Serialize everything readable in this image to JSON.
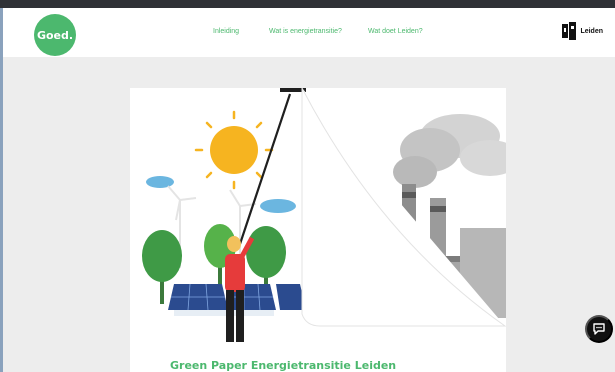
{
  "header": {
    "logo_text": "Goed.",
    "nav": [
      {
        "label": "Inleiding"
      },
      {
        "label": "Wat is energietransitie?"
      },
      {
        "label": "Wat doet Leiden?"
      }
    ],
    "brand_label": "Leiden"
  },
  "hero": {
    "title": "Green Paper Energietransitie Leiden"
  },
  "icons": {
    "chat": "chat-icon",
    "brand": "leiden-crest-icon"
  },
  "colors": {
    "accent": "#4cb86e",
    "background": "#ededed",
    "card": "#ffffff"
  }
}
